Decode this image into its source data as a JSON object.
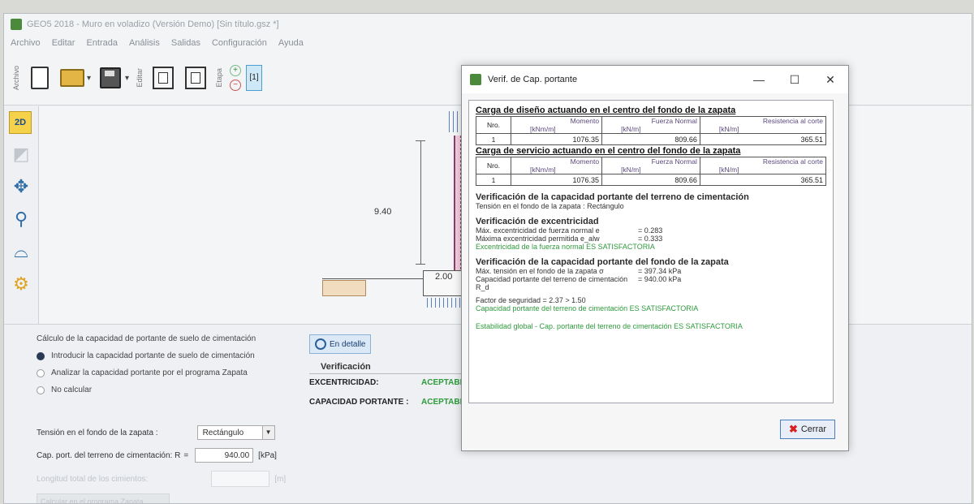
{
  "app": {
    "title": "GEO5 2018 - Muro en voladizo (Versión Demo) [Sin título.gsz *]",
    "menu": [
      "Archivo",
      "Editar",
      "Entrada",
      "Análisis",
      "Salidas",
      "Configuración",
      "Ayuda"
    ],
    "toolbar": {
      "group_file": "Archivo",
      "group_edit": "Editar",
      "group_stage": "Etapa",
      "stage_number": "[1]"
    }
  },
  "left_tools": {
    "view2d": "2D"
  },
  "canvas": {
    "dim_height": "9.40",
    "dim_small": "2.00"
  },
  "bottom_panel": {
    "calc_title": "Cálculo de la capacidad de portante de suelo de cimentación",
    "options": [
      "Introducir la capacidad portante de suelo de cimentación",
      "Analizar la capacidad portante por el programa Zapata",
      "No calcular"
    ],
    "stress_label": "Tensión en el fondo de la zapata :",
    "stress_value": "Rectángulo",
    "bearing_label": "Cap. port. del terreno de cimentación: R",
    "bearing_value": "940.00",
    "bearing_unit": "[kPa]",
    "length_label": "Longitud total de los cimientos:",
    "length_unit": "[m]",
    "zapata_button": "Calcular en el programa Zapata",
    "detail_button": "En detalle",
    "verif_title": "Verificación",
    "rows": [
      {
        "label": "EXCENTRICIDAD:",
        "status": "ACEPTABLE"
      },
      {
        "label": "CAPACIDAD PORTANTE :",
        "status": "ACEPTABLE"
      }
    ]
  },
  "dialog": {
    "title": "Verif. de Cap. portante",
    "controls": {
      "minimize": "—",
      "maximize": "☐",
      "close": "✕"
    },
    "table1": {
      "heading": "Carga de diseño actuando en el centro del fondo de la zapata",
      "col_nro": "Nro.",
      "cols": [
        {
          "name": "Momento",
          "unit": "[kNm/m]"
        },
        {
          "name": "Fuerza Normal",
          "unit": "[kN/m]"
        },
        {
          "name": "Resistencia al corte",
          "unit": "[kN/m]"
        }
      ],
      "row": {
        "nro": "1",
        "values": [
          "1076.35",
          "809.66",
          "365.51"
        ]
      }
    },
    "table2": {
      "heading": "Carga de servicio actuando en el centro del fondo de la zapata",
      "col_nro": "Nro.",
      "cols": [
        {
          "name": "Momento",
          "unit": "[kNm/m]"
        },
        {
          "name": "Fuerza Normal",
          "unit": "[kN/m]"
        },
        {
          "name": "Resistencia al corte",
          "unit": "[kN/m]"
        }
      ],
      "row": {
        "nro": "1",
        "values": [
          "1076.35",
          "809.66",
          "365.51"
        ]
      }
    },
    "bearing_section_title": "Verificación de la capacidad portante del terreno de cimentación",
    "bearing_section_sub": "Tensión en el fondo de la zapata : Rectángulo",
    "ecc_title": "Verificación de excentricidad",
    "ecc_rows": [
      {
        "k": "Máx. excentricidad de fuerza normal e",
        "v": "= 0.283"
      },
      {
        "k": "Máxima excentricidad permitida     e_alw",
        "v": "= 0.333"
      }
    ],
    "ecc_result": "Excentricidad de la fuerza normal ES SATISFACTORIA",
    "cap_title": "Verificación de la capacidad portante del fondo de la zapata",
    "cap_rows": [
      {
        "k": "Máx. tensión en el fondo de la zapata          σ",
        "v": "= 397.34 kPa"
      },
      {
        "k": "Capacidad portante del terreno de cimentación  R_d",
        "v": "= 940.00 kPa"
      }
    ],
    "safety_factor": "Factor de seguridad = 2.37 > 1.50",
    "cap_result": "Capacidad portante del terreno de cimentación ES SATISFACTORIA",
    "global_result": "Estabilidad global - Cap. portante del terreno de cimentación ES SATISFACTORIA",
    "close_label": "Cerrar"
  }
}
